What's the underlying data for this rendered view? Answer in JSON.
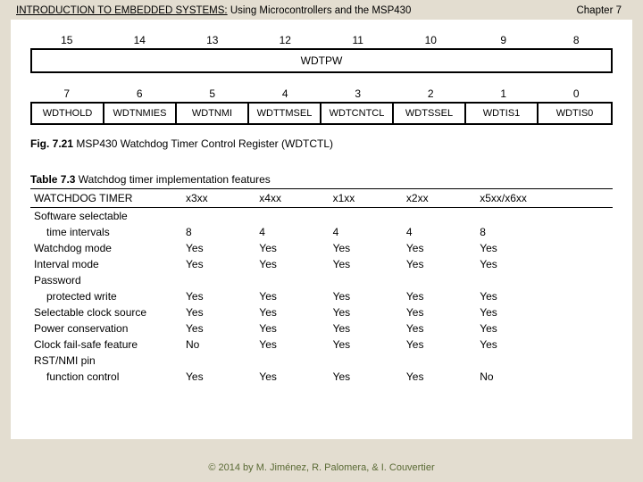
{
  "header": {
    "title_prefix": "INTRODUCTION TO EMBEDDED SYSTEMS:",
    "title_suffix": " Using Microcontrollers and the MSP430",
    "chapter": "Chapter 7"
  },
  "register": {
    "bits_high": [
      "15",
      "14",
      "13",
      "12",
      "11",
      "10",
      "9",
      "8"
    ],
    "row_high_label": "WDTPW",
    "bits_low": [
      "7",
      "6",
      "5",
      "4",
      "3",
      "2",
      "1",
      "0"
    ],
    "row_low": [
      "WDTHOLD",
      "WDTNMIES",
      "WDTNMI",
      "WDTTMSEL",
      "WDTCNTCL",
      "WDTSSEL",
      "WDTIS1",
      "WDTIS0"
    ],
    "fig_label": "Fig. 7.21",
    "fig_text": "  MSP430 Watchdog Timer Control Register (WDTCTL)"
  },
  "table": {
    "cap_label": "Table 7.3",
    "cap_text": "  Watchdog timer implementation features",
    "headers": [
      "WATCHDOG TIMER",
      "x3xx",
      "x4xx",
      "x1xx",
      "x2xx",
      "x5xx/x6xx"
    ],
    "rows": [
      {
        "label": "Software selectable",
        "indent": false,
        "vals": [
          "",
          "",
          "",
          "",
          ""
        ]
      },
      {
        "label": "time intervals",
        "indent": true,
        "vals": [
          "8",
          "4",
          "4",
          "4",
          "8"
        ]
      },
      {
        "label": "Watchdog mode",
        "indent": false,
        "vals": [
          "Yes",
          "Yes",
          "Yes",
          "Yes",
          "Yes"
        ]
      },
      {
        "label": "Interval mode",
        "indent": false,
        "vals": [
          "Yes",
          "Yes",
          "Yes",
          "Yes",
          "Yes"
        ]
      },
      {
        "label": "Password",
        "indent": false,
        "vals": [
          "",
          "",
          "",
          "",
          ""
        ]
      },
      {
        "label": "protected write",
        "indent": true,
        "vals": [
          "Yes",
          "Yes",
          "Yes",
          "Yes",
          "Yes"
        ]
      },
      {
        "label": "Selectable clock source",
        "indent": false,
        "vals": [
          "Yes",
          "Yes",
          "Yes",
          "Yes",
          "Yes"
        ]
      },
      {
        "label": "Power conservation",
        "indent": false,
        "vals": [
          "Yes",
          "Yes",
          "Yes",
          "Yes",
          "Yes"
        ]
      },
      {
        "label": "Clock fail-safe feature",
        "indent": false,
        "vals": [
          "No",
          "Yes",
          "Yes",
          "Yes",
          "Yes"
        ]
      },
      {
        "label": "RST/NMI pin",
        "indent": false,
        "vals": [
          "",
          "",
          "",
          "",
          ""
        ]
      },
      {
        "label": "function control",
        "indent": true,
        "vals": [
          "Yes",
          "Yes",
          "Yes",
          "Yes",
          "No"
        ]
      }
    ]
  },
  "footer": "© 2014 by M. Jiménez, R. Palomera, & I. Couvertier"
}
